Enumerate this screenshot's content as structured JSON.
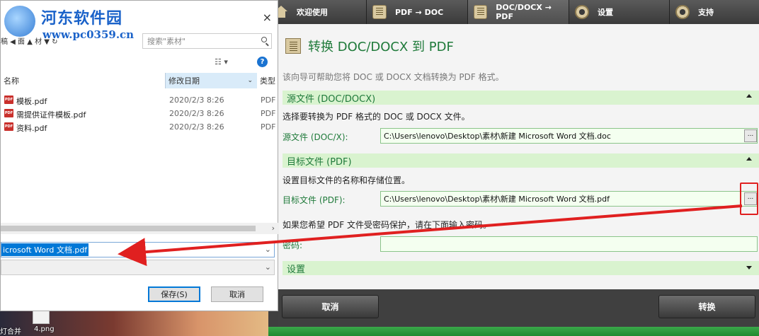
{
  "watermark": {
    "title": "河东软件园",
    "url": "www.pc0359.cn"
  },
  "desktop": {
    "labels": [
      "灯合并",
      "4.png"
    ]
  },
  "app": {
    "tabs": [
      {
        "label": "欢迎使用",
        "icon": "home-icon"
      },
      {
        "label": "PDF → DOC",
        "icon": "document-icon"
      },
      {
        "label": "DOC/DOCX → PDF",
        "icon": "document-icon",
        "active": true
      },
      {
        "label": "设置",
        "icon": "gear-icon"
      },
      {
        "label": "支持",
        "icon": "lifebuoy-icon"
      }
    ],
    "page_title": "转换 DOC/DOCX 到 PDF",
    "intro": "该向导可帮助您将 DOC 或 DOCX 文档转换为 PDF 格式。",
    "source": {
      "section": "源文件 (DOC/DOCX)",
      "desc": "选择要转换为 PDF 格式的 DOC 或 DOCX 文件。",
      "label": "源文件 (DOC/X):",
      "value": "C:\\Users\\lenovo\\Desktop\\素材\\新建 Microsoft Word 文档.doc",
      "browse": "..."
    },
    "target": {
      "section": "目标文件 (PDF)",
      "desc": "设置目标文件的名称和存储位置。",
      "label": "目标文件 (PDF):",
      "value": "C:\\Users\\lenovo\\Desktop\\素材\\新建 Microsoft Word 文档.pdf",
      "browse": "..."
    },
    "password": {
      "desc": "如果您希望 PDF 文件受密码保护，请在下面输入密码。",
      "label": "密码:",
      "value": ""
    },
    "settings_section": "设置",
    "cancel_button": "取消",
    "convert_button": "转换",
    "accent": "#1f7a3a",
    "section_bg": "#d9f3cf"
  },
  "dialog": {
    "close": "×",
    "nav_fragment": "稿  ◀ 面   ▲ 材  ▼ ↻",
    "search_placeholder": "搜索\"素材\"",
    "view_label": "☷ ▾",
    "help": "?",
    "columns": {
      "name": "名称",
      "date": "修改日期",
      "type": "类型"
    },
    "files": [
      {
        "name": "模板.pdf",
        "date": "2020/2/3 8:26",
        "type": "PDF"
      },
      {
        "name": "需提供证件模板.pdf",
        "date": "2020/2/3 8:26",
        "type": "PDF"
      },
      {
        "name": "资料.pdf",
        "date": "2020/2/3 8:26",
        "type": "PDF"
      }
    ],
    "filename_value": "icrosoft Word 文档.pdf",
    "filetype_value": "",
    "save_button": "保存(S)",
    "cancel_button": "取消"
  }
}
